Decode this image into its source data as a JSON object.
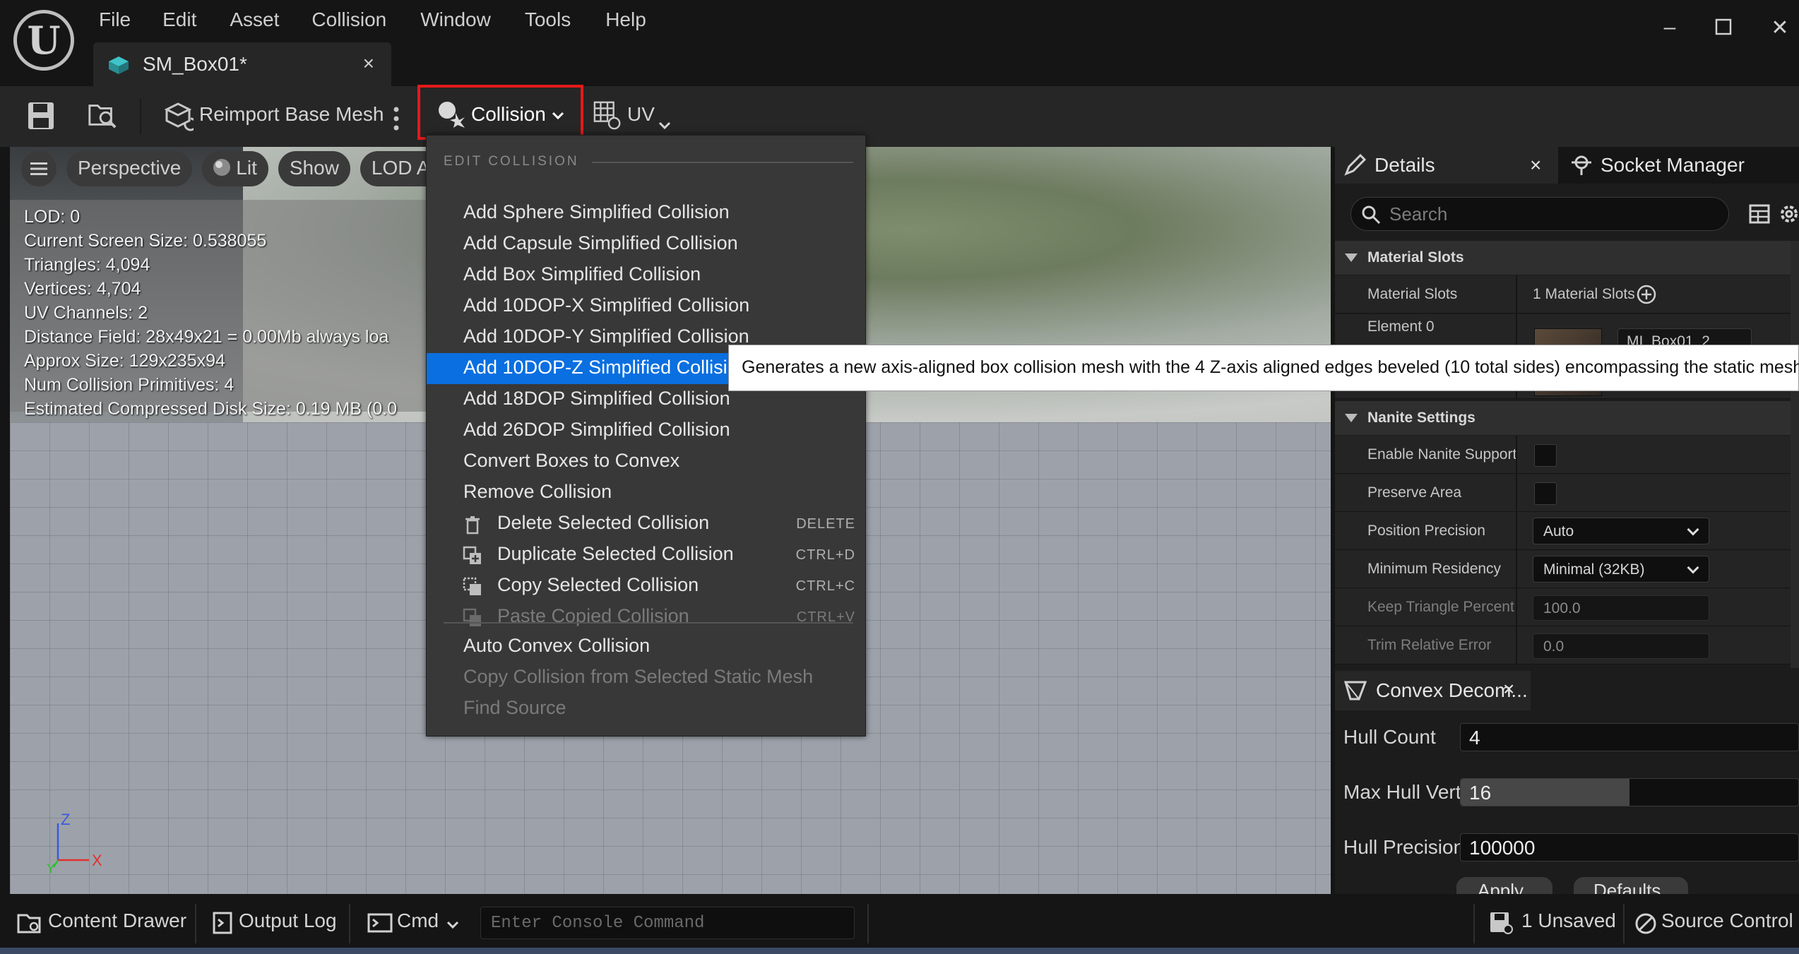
{
  "window": {
    "menus": [
      "File",
      "Edit",
      "Asset",
      "Collision",
      "Window",
      "Tools",
      "Help"
    ],
    "tab_title": "SM_Box01*",
    "controls": [
      "minimize",
      "maximize",
      "close"
    ]
  },
  "toolbar": {
    "reimport_label": "Reimport Base Mesh",
    "collision_label": "Collision",
    "uv_label": "UV"
  },
  "viewport": {
    "perspective_label": "Perspective",
    "lit_label": "Lit",
    "show_label": "Show",
    "lod_label": "LOD Au",
    "stats": [
      "LOD:  0",
      "Current Screen Size:  0.538055",
      "Triangles:  4,094",
      "Vertices:  4,704",
      "UV Channels:  2",
      "Distance Field:  28x49x21 = 0.00Mb always loa",
      "Approx Size: 129x235x94",
      "Num Collision Primitives:  4",
      "Estimated Compressed Disk Size: 0.19 MB (0.0"
    ],
    "axis": {
      "z": "Z",
      "x": "X",
      "y": "Y"
    }
  },
  "collision_menu": {
    "section_title": "EDIT COLLISION",
    "items": [
      {
        "label": "Add Sphere Simplified Collision"
      },
      {
        "label": "Add Capsule Simplified Collision"
      },
      {
        "label": "Add Box Simplified Collision"
      },
      {
        "label": "Add 10DOP-X Simplified Collision"
      },
      {
        "label": "Add 10DOP-Y Simplified Collision"
      },
      {
        "label": "Add 10DOP-Z Simplified Collisi"
      },
      {
        "label": "Add 18DOP Simplified Collision"
      },
      {
        "label": "Add 26DOP Simplified Collision"
      },
      {
        "label": "Convert Boxes to Convex"
      },
      {
        "label": "Remove Collision"
      },
      {
        "label": "Delete Selected Collision",
        "shortcut": "DELETE"
      },
      {
        "label": "Duplicate Selected Collision",
        "shortcut": "CTRL+D"
      },
      {
        "label": "Copy Selected Collision",
        "shortcut": "CTRL+C"
      },
      {
        "label": "Paste Copied Collision",
        "shortcut": "CTRL+V"
      },
      {
        "label": "Auto Convex Collision"
      },
      {
        "label": "Copy Collision from Selected Static Mesh"
      },
      {
        "label": "Find Source"
      }
    ],
    "highlighted_index": 5,
    "highlight_color": "#0a6fe0"
  },
  "tooltip": "Generates a new axis-aligned box collision mesh with the 4 Z-axis aligned edges beveled (10 total sides) encompassing the static mesh.",
  "details": {
    "tab_label": "Details",
    "socket_tab_label": "Socket Manager",
    "search_placeholder": "Search",
    "material_slots": {
      "header": "Material Slots",
      "row_label": "Material Slots",
      "row_value": "1 Material Slots",
      "element_label": "Element 0",
      "material_name": "MI_Box01_2"
    },
    "nanite": {
      "header": "Nanite Settings",
      "enable_label": "Enable Nanite Support",
      "preserve_label": "Preserve Area",
      "position_label": "Position Precision",
      "position_value": "Auto",
      "residency_label": "Minimum Residency",
      "residency_value": "Minimal (32KB)",
      "keep_label": "Keep Triangle Percent",
      "keep_value": "100.0",
      "trim_label": "Trim Relative Error",
      "trim_value": "0.0"
    }
  },
  "convex": {
    "tab_label": "Convex Decom...",
    "hull_count_label": "Hull Count",
    "hull_count_value": "4",
    "max_verts_label": "Max Hull Verts",
    "max_verts_value": "16",
    "max_verts_fill_fraction": 0.5,
    "precision_label": "Hull Precision",
    "precision_value": "100000",
    "apply_label": "Apply",
    "defaults_label": "Defaults"
  },
  "statusbar": {
    "content_drawer": "Content Drawer",
    "output_log": "Output Log",
    "cmd": "Cmd",
    "console_placeholder": "Enter Console Command",
    "unsaved": "1 Unsaved",
    "source_control": "Source Control"
  }
}
